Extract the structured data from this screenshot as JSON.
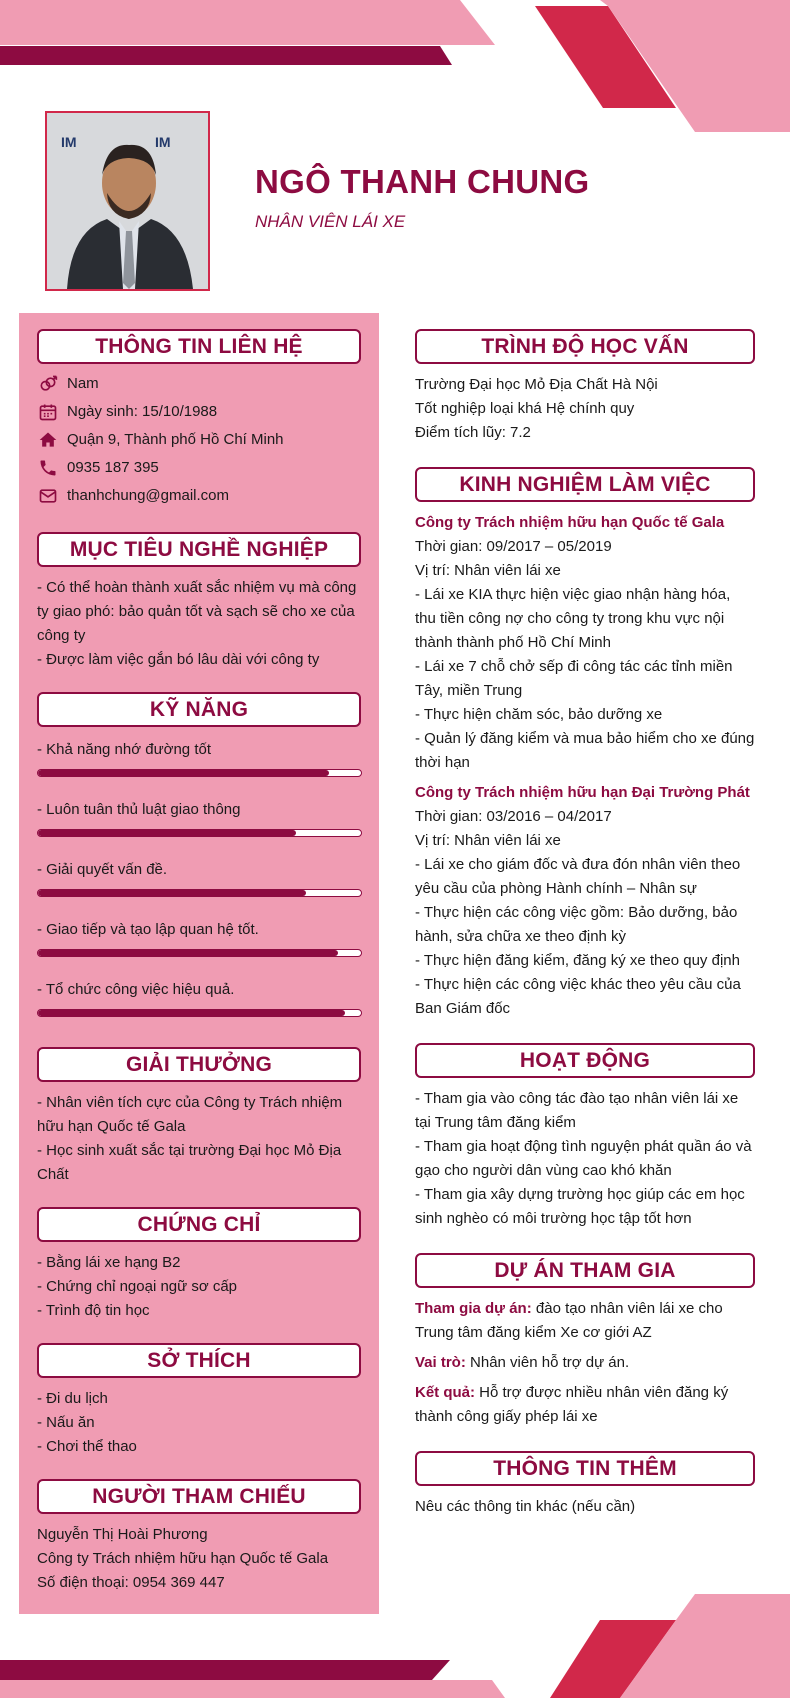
{
  "header": {
    "name": "NGÔ THANH CHUNG",
    "job_title": "NHÂN VIÊN LÁI XE",
    "avatar_alt": "Ảnh đại diện"
  },
  "colors": {
    "primary": "#8d0b41",
    "pink": "#f09cb3",
    "red": "#d1284a"
  },
  "contact": {
    "heading": "THÔNG TIN LIÊN HỆ",
    "items": [
      {
        "icon": "gender-icon",
        "text": "Nam"
      },
      {
        "icon": "calendar-icon",
        "text": "Ngày sinh: 15/10/1988"
      },
      {
        "icon": "home-icon",
        "text": "Quận 9, Thành phố Hồ Chí Minh"
      },
      {
        "icon": "phone-icon",
        "text": "0935 187 395"
      },
      {
        "icon": "email-icon",
        "text": "thanhchung@gmail.com"
      }
    ]
  },
  "objective": {
    "heading": "MỤC TIÊU NGHỀ NGHIỆP",
    "lines": [
      "- Có thể hoàn thành xuất sắc nhiệm vụ mà công ty giao phó: bảo quản tốt và sạch sẽ cho xe của công ty",
      "- Được làm việc gắn bó lâu dài với công ty"
    ]
  },
  "skills": {
    "heading": "KỸ NĂNG",
    "items": [
      {
        "label": "- Khả năng nhớ đường tốt",
        "level": 0.9
      },
      {
        "label": "- Luôn tuân thủ luật giao thông",
        "level": 0.8
      },
      {
        "label": "- Giải quyết vấn đề.",
        "level": 0.83
      },
      {
        "label": "- Giao tiếp và tạo lập quan hệ tốt.",
        "level": 0.93
      },
      {
        "label": "- Tổ chức công việc hiệu quả.",
        "level": 0.95
      }
    ]
  },
  "awards": {
    "heading": "GIẢI THƯỞNG",
    "lines": [
      "- Nhân viên tích cực của Công ty Trách nhiệm hữu hạn Quốc tế Gala",
      "- Học sinh xuất sắc tại trường Đại học Mỏ Địa Chất"
    ]
  },
  "certificates": {
    "heading": "CHỨNG CHỈ",
    "lines": [
      "- Bằng lái xe hạng B2",
      "- Chứng chỉ ngoại ngữ sơ cấp",
      "- Trình độ tin học"
    ]
  },
  "hobbies": {
    "heading": "SỞ THÍCH",
    "lines": [
      "- Đi du lịch",
      "- Nấu ăn",
      "- Chơi thể thao"
    ]
  },
  "references": {
    "heading": "NGƯỜI THAM CHIẾU",
    "lines": [
      "Nguyễn Thị Hoài Phương",
      "Công ty Trách nhiệm hữu hạn Quốc tế Gala",
      "Số điện thoại: 0954 369 447"
    ]
  },
  "education": {
    "heading": "TRÌNH ĐỘ HỌC VẤN",
    "lines": [
      "Trường Đại học Mỏ Địa Chất Hà Nội",
      "Tốt nghiệp loại khá Hệ chính quy",
      "Điểm tích lũy: 7.2"
    ]
  },
  "experience": {
    "heading": "KINH NGHIỆM LÀM VIỆC",
    "jobs": [
      {
        "company": "Công ty Trách nhiệm hữu hạn Quốc tế Gala",
        "lines": [
          "Thời gian: 09/2017 – 05/2019",
          "Vị trí: Nhân viên lái xe",
          "- Lái xe KIA thực hiện việc giao nhận hàng hóa, thu tiền công nợ cho công ty trong khu vực nội thành thành phố Hồ Chí Minh",
          "- Lái xe 7 chỗ chở sếp đi công tác các tỉnh miền Tây, miền Trung",
          "- Thực hiện chăm sóc, bảo dưỡng xe",
          "- Quản lý đăng kiểm và mua bảo hiểm cho xe đúng thời hạn"
        ]
      },
      {
        "company": "Công ty Trách nhiệm hữu hạn Đại Trường Phát",
        "lines": [
          "Thời gian: 03/2016 – 04/2017",
          "Vị trí: Nhân viên lái xe",
          "- Lái xe cho giám đốc và đưa đón nhân viên theo yêu cầu của phòng Hành chính – Nhân sự",
          "- Thực hiện các công việc gồm: Bảo dưỡng, bảo hành, sửa chữa xe theo định kỳ",
          "- Thực hiện đăng kiểm, đăng ký xe theo quy định",
          "- Thực hiện các công việc khác theo yêu cầu của Ban Giám đốc"
        ]
      }
    ]
  },
  "activities": {
    "heading": "HOẠT ĐỘNG",
    "lines": [
      "- Tham gia vào công tác đào tạo nhân viên lái xe tại Trung tâm đăng kiểm",
      "- Tham gia hoạt động tình nguyện phát quần áo và gạo cho người dân vùng cao khó khăn",
      "- Tham gia xây dựng trường học giúp các em học sinh nghèo có môi trường học tập tốt hơn"
    ]
  },
  "projects": {
    "heading": "DỰ ÁN THAM GIA",
    "items": [
      {
        "label": "Tham gia dự án:",
        "text": " đào tạo nhân viên lái xe cho Trung tâm đăng kiểm Xe cơ giới AZ"
      },
      {
        "label": "Vai trò:",
        "text": " Nhân viên hỗ trợ dự án."
      },
      {
        "label": "Kết quả:",
        "text": " Hỗ trợ được nhiều nhân viên đăng ký thành công giấy phép lái xe"
      }
    ]
  },
  "extra": {
    "heading": "THÔNG TIN THÊM",
    "text": "Nêu các thông tin khác (nếu cần)"
  }
}
